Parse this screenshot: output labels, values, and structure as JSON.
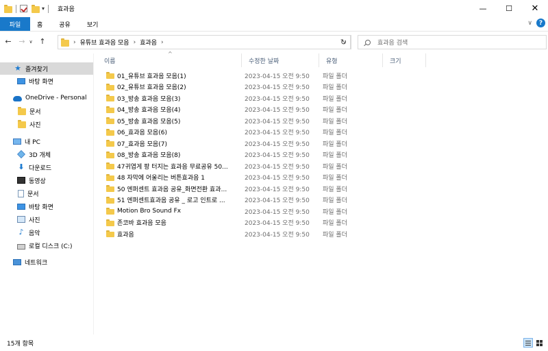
{
  "window": {
    "title": "효과음",
    "minimize_glyph": "—",
    "maximize_glyph": "☐",
    "close_glyph": "✕"
  },
  "ribbon": {
    "tabs": [
      "파일",
      "홈",
      "공유",
      "보기"
    ]
  },
  "address": {
    "crumbs": [
      "유튜브 효과음 모음",
      "효과음"
    ]
  },
  "search": {
    "placeholder": "효과음 검색"
  },
  "sidebar": {
    "items": [
      {
        "label": "즐겨찾기",
        "icon": "star-icon",
        "selected": true
      },
      {
        "label": "바탕 화면",
        "icon": "desktop-icon"
      },
      {
        "label": "OneDrive - Personal",
        "icon": "cloud-icon"
      },
      {
        "label": "문서",
        "icon": "folder-icon"
      },
      {
        "label": "사진",
        "icon": "folder-icon"
      },
      {
        "label": "내 PC",
        "icon": "pc-icon"
      },
      {
        "label": "3D 개체",
        "icon": "cube-icon"
      },
      {
        "label": "다운로드",
        "icon": "download-icon"
      },
      {
        "label": "동영상",
        "icon": "video-icon"
      },
      {
        "label": "문서",
        "icon": "document-icon"
      },
      {
        "label": "바탕 화면",
        "icon": "desktop-icon"
      },
      {
        "label": "사진",
        "icon": "picture-icon"
      },
      {
        "label": "음악",
        "icon": "music-icon"
      },
      {
        "label": "로컬 디스크 (C:)",
        "icon": "drive-icon"
      },
      {
        "label": "네트워크",
        "icon": "network-icon"
      }
    ]
  },
  "columns": {
    "name": "이름",
    "date": "수정한 날짜",
    "type": "유형",
    "size": "크기"
  },
  "files": [
    {
      "name": "01_유튜브 효과음 모음(1)",
      "date": "2023-04-15 오전 9:50",
      "type": "파일 폴더"
    },
    {
      "name": "02_유튜브 효과음 모음(2)",
      "date": "2023-04-15 오전 9:50",
      "type": "파일 폴더"
    },
    {
      "name": "03_방송 효과음 모음(3)",
      "date": "2023-04-15 오전 9:50",
      "type": "파일 폴더"
    },
    {
      "name": "04_방송 효과음 모음(4)",
      "date": "2023-04-15 오전 9:50",
      "type": "파일 폴더"
    },
    {
      "name": "05_방송 효과음 모음(5)",
      "date": "2023-04-15 오전 9:50",
      "type": "파일 폴더"
    },
    {
      "name": "06_효과음 모음(6)",
      "date": "2023-04-15 오전 9:50",
      "type": "파일 폴더"
    },
    {
      "name": "07_효과음 모음(7)",
      "date": "2023-04-15 오전 9:50",
      "type": "파일 폴더"
    },
    {
      "name": "08_방송 효과음 모음(8)",
      "date": "2023-04-15 오전 9:50",
      "type": "파일 폴더"
    },
    {
      "name": "47귀엽게 팡 터지는 효과음 무료공유 50...",
      "date": "2023-04-15 오전 9:50",
      "type": "파일 폴더"
    },
    {
      "name": "48 자막에 어울리는 버튼효과음 1",
      "date": "2023-04-15 오전 9:50",
      "type": "파일 폴더"
    },
    {
      "name": "50 엔퍼센트 효과음 공유_화면전환 효과...",
      "date": "2023-04-15 오전 9:50",
      "type": "파일 폴더"
    },
    {
      "name": "51 엔퍼센트효과음 공유 _ 로고 인트로 ...",
      "date": "2023-04-15 오전 9:50",
      "type": "파일 폴더"
    },
    {
      "name": "Motion Bro Sound Fx",
      "date": "2023-04-15 오전 9:50",
      "type": "파일 폴더"
    },
    {
      "name": "존코바 효과음 모음",
      "date": "2023-04-15 오전 9:50",
      "type": "파일 폴더"
    },
    {
      "name": "효과음",
      "date": "2023-04-15 오전 9:50",
      "type": "파일 폴더"
    }
  ],
  "status": {
    "item_count": "15개 항목"
  }
}
